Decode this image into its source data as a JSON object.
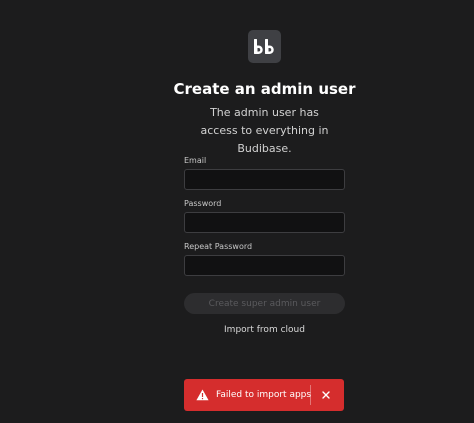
{
  "logo": {
    "icon": "budibase-logo-icon"
  },
  "heading": {
    "title": "Create an admin user",
    "subtitle": "The admin user has access to everything in Budibase."
  },
  "form": {
    "email_label": "Email",
    "email_value": "",
    "password_label": "Password",
    "password_value": "",
    "repeat_password_label": "Repeat Password",
    "repeat_password_value": "",
    "submit_label": "Create super admin user",
    "import_link": "Import from cloud"
  },
  "toast": {
    "icon": "alert-icon",
    "message": "Failed to import apps",
    "close_icon": "close-icon",
    "color": "#d52d2d"
  },
  "colors": {
    "background": "#1c1c1d",
    "input_background": "#111112",
    "disabled_button": "#2d2d2f"
  }
}
